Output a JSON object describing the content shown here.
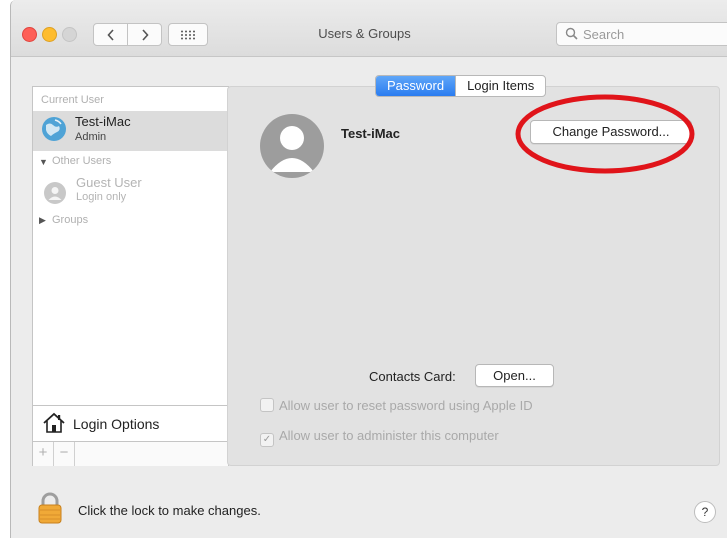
{
  "window": {
    "title": "Users & Groups"
  },
  "search": {
    "placeholder": "Search"
  },
  "tabs": [
    {
      "label": "Password",
      "active": true
    },
    {
      "label": "Login Items",
      "active": false
    }
  ],
  "sidebar": {
    "current_user_header": "Current User",
    "current_user": {
      "name": "Test-iMac",
      "role": "Admin"
    },
    "other_users_header": "Other Users",
    "guest": {
      "name": "Guest User",
      "status": "Login only"
    },
    "groups_header": "Groups",
    "login_options": "Login Options",
    "add_symbol": "+",
    "remove_symbol": "−"
  },
  "main": {
    "user_name": "Test-iMac",
    "change_password": "Change Password...",
    "contacts_label": "Contacts Card:",
    "open_button": "Open...",
    "checkbox_reset": {
      "label": "Allow user to reset password using Apple ID",
      "checked": false
    },
    "checkbox_admin": {
      "label": "Allow user to administer this computer",
      "checked": true
    }
  },
  "footer": {
    "lock_text": "Click the lock to make changes.",
    "help_symbol": "?"
  },
  "colors": {
    "accent": "#2a7cf0",
    "highlight_ring": "#e0141a"
  },
  "icons": [
    "back-chevron-icon",
    "forward-chevron-icon",
    "grid-icon",
    "search-icon",
    "globe-avatar-icon",
    "guest-avatar-icon",
    "house-icon",
    "user-silhouette-icon",
    "lock-icon"
  ]
}
